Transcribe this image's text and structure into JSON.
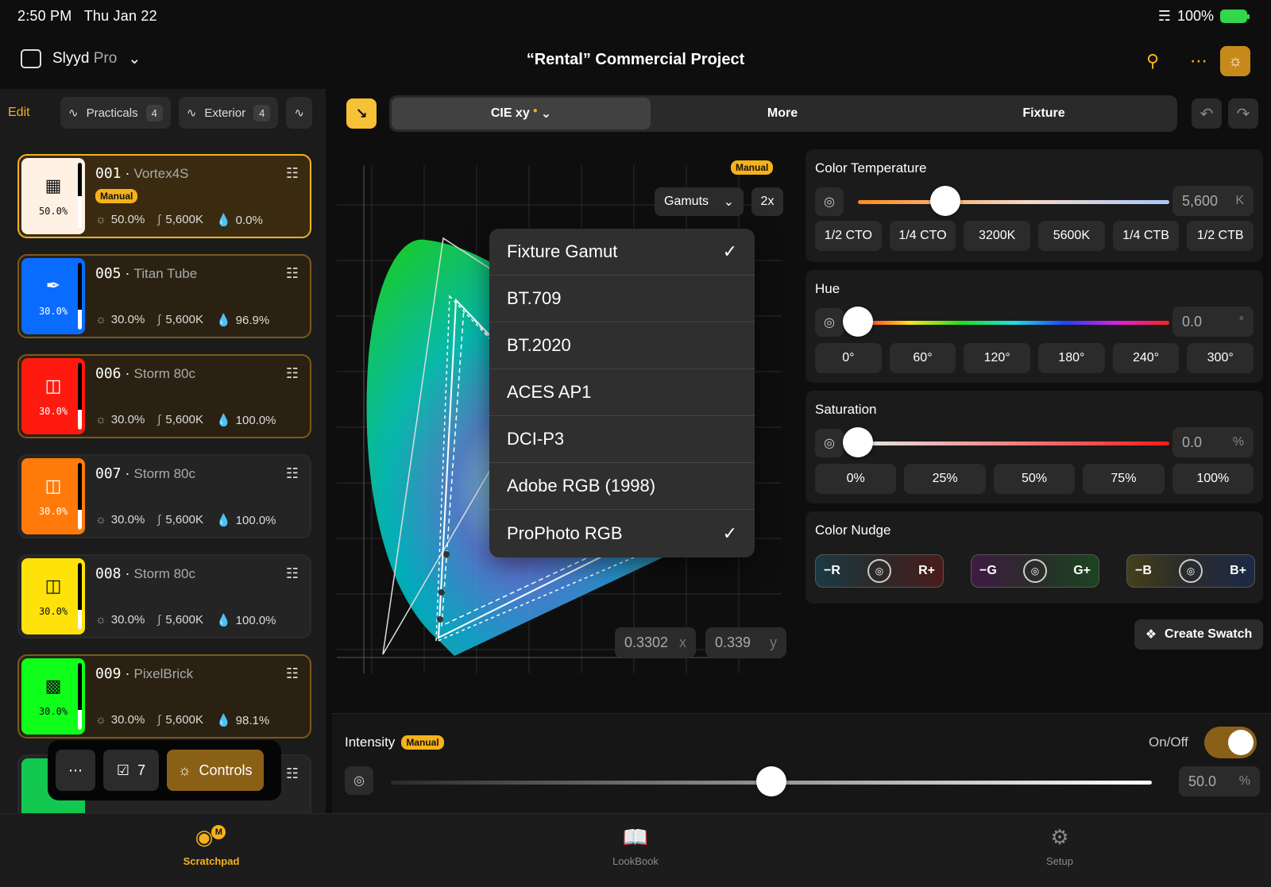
{
  "status": {
    "time": "2:50 PM",
    "date": "Thu Jan 22",
    "battery": "100%"
  },
  "header": {
    "app_name": "Slyyd",
    "app_tier": "Pro",
    "project_title": "“Rental” Commercial Project"
  },
  "filters": {
    "edit_label": "Edit",
    "items": [
      {
        "label": "Practicals",
        "count": "4"
      },
      {
        "label": "Exterior",
        "count": "4"
      }
    ]
  },
  "fixtures": [
    {
      "number": "001",
      "name": "Vortex4S",
      "swatch": "#fff1e4",
      "intensity_pct": "50.0%",
      "cct": "5,600K",
      "sat": "0.0%",
      "manual": "Manual",
      "icon": "panel-icon",
      "fill": 0.5
    },
    {
      "number": "005",
      "name": "Titan Tube",
      "swatch": "#0a6cff",
      "intensity_pct": "30.0%",
      "cct": "5,600K",
      "sat": "96.9%",
      "icon": "tube-icon",
      "fill": 0.3
    },
    {
      "number": "006",
      "name": "Storm 80c",
      "swatch": "#ff1a10",
      "intensity_pct": "30.0%",
      "cct": "5,600K",
      "sat": "100.0%",
      "icon": "fresnel-icon",
      "fill": 0.3
    },
    {
      "number": "007",
      "name": "Storm 80c",
      "swatch": "#ff7a0a",
      "intensity_pct": "30.0%",
      "cct": "5,600K",
      "sat": "100.0%",
      "icon": "fresnel-icon",
      "fill": 0.3
    },
    {
      "number": "008",
      "name": "Storm 80c",
      "swatch": "#ffe20a",
      "intensity_pct": "30.0%",
      "cct": "5,600K",
      "sat": "100.0%",
      "icon": "fresnel-icon",
      "fill": 0.3
    },
    {
      "number": "009",
      "name": "PixelBrick",
      "swatch": "#10ff1a",
      "intensity_pct": "30.0%",
      "cct": "5,600K",
      "sat": "98.1%",
      "icon": "brick-icon",
      "fill": 0.3
    }
  ],
  "floatbar": {
    "selected_count": "7",
    "controls_label": "Controls"
  },
  "mode_tabs": {
    "cie_label": "CIE xy",
    "more_label": "More",
    "fixture_label": "Fixture"
  },
  "chart": {
    "manual_badge": "Manual",
    "gamuts_label": "Gamuts",
    "zoom_label": "2x",
    "x_value": "0.3302",
    "x_unit": "x",
    "y_value": "0.339",
    "y_unit": "y"
  },
  "gamut_menu": {
    "items": [
      {
        "label": "Fixture Gamut",
        "checked": true
      },
      {
        "label": "BT.709",
        "checked": false
      },
      {
        "label": "BT.2020",
        "checked": false
      },
      {
        "label": "ACES AP1",
        "checked": false
      },
      {
        "label": "DCI-P3",
        "checked": false
      },
      {
        "label": "Adobe RGB (1998)",
        "checked": false
      },
      {
        "label": "ProPhoto RGB",
        "checked": true
      }
    ]
  },
  "color_temp": {
    "title": "Color Temperature",
    "value": "5,600",
    "unit": "K",
    "level": 0.28,
    "presets": [
      "1/2 CTO",
      "1/4 CTO",
      "3200K",
      "5600K",
      "1/4 CTB",
      "1/2 CTB"
    ]
  },
  "hue": {
    "title": "Hue",
    "value": "0.0",
    "unit": "°",
    "level": 0,
    "presets": [
      "0°",
      "60°",
      "120°",
      "180°",
      "240°",
      "300°"
    ]
  },
  "saturation": {
    "title": "Saturation",
    "value": "0.0",
    "unit": "%",
    "level": 0,
    "presets": [
      "0%",
      "25%",
      "50%",
      "75%",
      "100%"
    ]
  },
  "color_nudge": {
    "title": "Color Nudge",
    "r_minus": "−R",
    "r_plus": "R+",
    "g_minus": "−G",
    "g_plus": "G+",
    "b_minus": "−B",
    "b_plus": "B+"
  },
  "create_swatch_label": "Create Swatch",
  "intensity": {
    "title": "Intensity",
    "manual_badge": "Manual",
    "onoff_label": "On/Off",
    "value": "50.0",
    "unit": "%",
    "level": 0.5
  },
  "tabbar": {
    "scratchpad": "Scratchpad",
    "scratchpad_badge": "M",
    "lookbook": "LookBook",
    "setup": "Setup"
  },
  "colors": {
    "accent": "#f6b21b",
    "background": "#0e0e0e"
  }
}
